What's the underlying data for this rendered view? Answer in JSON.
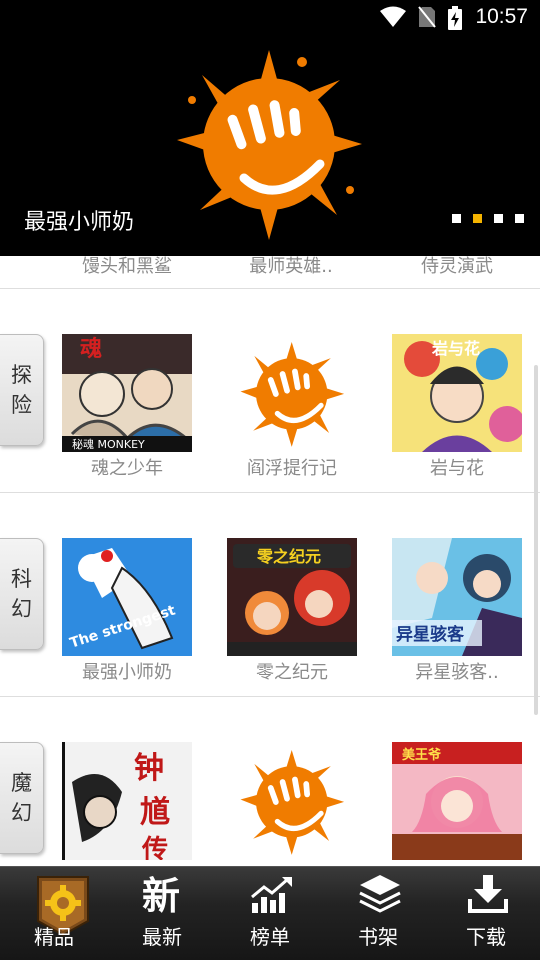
{
  "status_bar": {
    "time": "10:57"
  },
  "banner": {
    "title": "最强小师奶",
    "dots": [
      false,
      true,
      false,
      false
    ]
  },
  "previous_row": {
    "names": [
      "馒头和黑鲨",
      "最师英雄..",
      "侍灵演武"
    ]
  },
  "categories": [
    {
      "tab": [
        "探",
        "险"
      ],
      "items": [
        {
          "name": "魂之少年",
          "cover_caption": "秘魂 MONKEY"
        },
        {
          "name": "阎浮提行记",
          "cover_caption": ""
        },
        {
          "name": "岩与花",
          "cover_caption": ""
        }
      ]
    },
    {
      "tab": [
        "科",
        "幻"
      ],
      "items": [
        {
          "name": "最强小师奶",
          "cover_caption": "The strongest"
        },
        {
          "name": "零之纪元",
          "cover_caption": "零之纪元"
        },
        {
          "name": "异星骇客..",
          "cover_caption": "异星骇客"
        }
      ]
    },
    {
      "tab": [
        "魔",
        "幻"
      ],
      "items": [
        {
          "name": "",
          "cover_caption": "钟"
        },
        {
          "name": "",
          "cover_caption": ""
        },
        {
          "name": "",
          "cover_caption": ""
        }
      ]
    }
  ],
  "bottom_nav": [
    {
      "label": "精品",
      "icon": "gear-badge-icon",
      "active": true
    },
    {
      "label": "最新",
      "icon": "new-icon",
      "active": false
    },
    {
      "label": "榜单",
      "icon": "chart-icon",
      "active": false
    },
    {
      "label": "书架",
      "icon": "layers-icon",
      "active": false
    },
    {
      "label": "下载",
      "icon": "download-icon",
      "active": false
    }
  ],
  "colors": {
    "accent": "#f5b400",
    "logo_orange": "#f07c00"
  }
}
